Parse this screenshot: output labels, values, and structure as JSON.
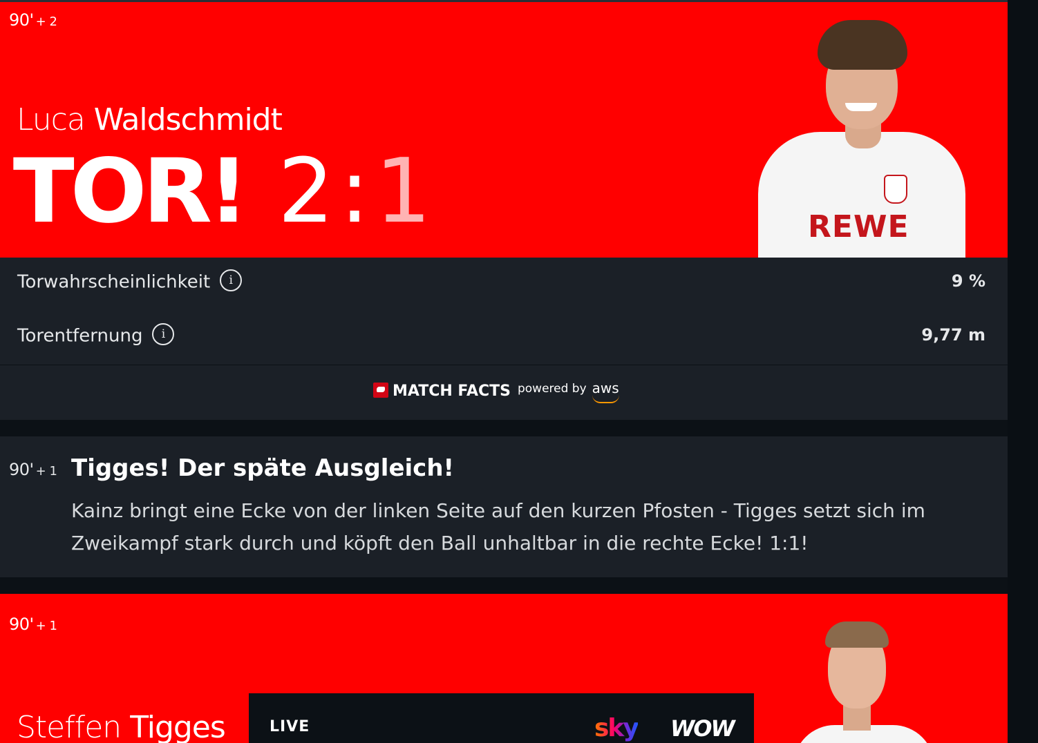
{
  "goal1": {
    "minute": "90'",
    "added": "+ 2",
    "first_name": "Luca",
    "last_name": "Waldschmidt",
    "headline": "TOR!",
    "score_home": "2",
    "score_sep": ":",
    "score_away": "1",
    "sponsor": "REWE"
  },
  "match_facts": {
    "rows": [
      {
        "label": "Torwahrscheinlichkeit",
        "value": "9 %",
        "icon": "info-icon"
      },
      {
        "label": "Torentfernung",
        "value": "9,77 m",
        "icon": "info-icon"
      }
    ],
    "info_glyph": "i",
    "brand": "MATCH FACTS",
    "powered_by": "powered by",
    "partner": "aws"
  },
  "comment": {
    "minute": "90'",
    "added": "+ 1",
    "title": "Tigges! Der späte Ausgleich!",
    "body": "Kainz bringt eine Ecke von der linken Seite auf den kurzen Pfosten - Tigges setzt sich im Zweikampf stark durch und köpft den Ball unhaltbar in die rechte Ecke! 1:1!"
  },
  "goal2": {
    "minute": "90'",
    "added": "+ 1",
    "first_name": "Steffen",
    "last_name": "Tigges"
  },
  "live_bar": {
    "label": "LIVE",
    "provider1": "sky",
    "provider2": "WOW"
  },
  "colors": {
    "goal_red": "#ff0000",
    "panel": "#1b2027",
    "background": "#0c1116"
  }
}
